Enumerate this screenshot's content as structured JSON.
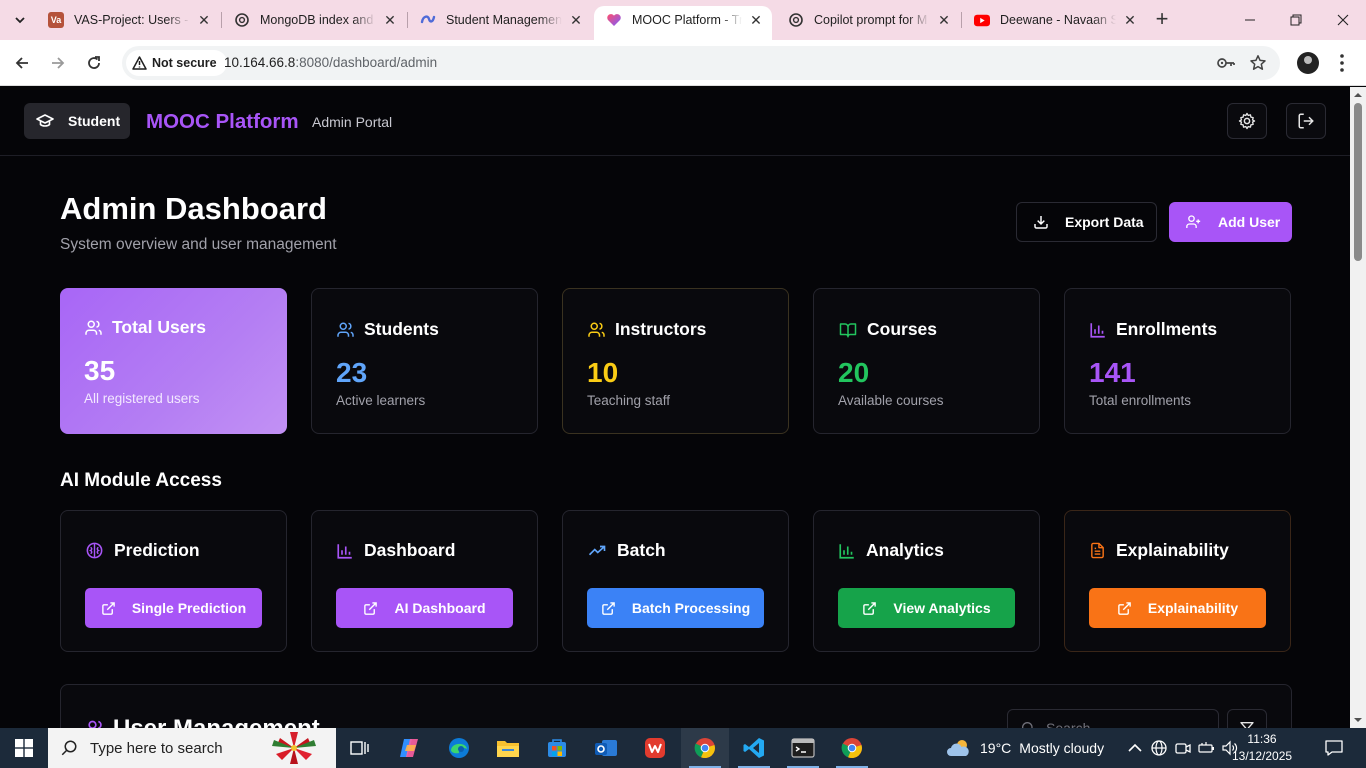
{
  "browser": {
    "tabs": [
      {
        "title": "VAS-Project: Users - A",
        "favicon_text": "Va",
        "favicon_color": "#b5523b",
        "active": false
      },
      {
        "title": "MongoDB index and",
        "favicon_icon": "openai-icon",
        "active": false
      },
      {
        "title": "Student Management",
        "favicon_icon": "copilot-icon",
        "active": false
      },
      {
        "title": "MOOC Platform - Tra",
        "favicon_icon": "lovable-heart-icon",
        "active": true
      },
      {
        "title": "Copilot prompt for M",
        "favicon_icon": "openai-icon",
        "active": false
      },
      {
        "title": "Deewane - Navaan S",
        "favicon_icon": "youtube-icon",
        "active": false
      }
    ],
    "security_label": "Not secure",
    "url_host": "10.164.66.8",
    "url_rest": ":8080/dashboard/admin"
  },
  "header": {
    "role_label": "Student",
    "brand": "MOOC Platform",
    "portal": "Admin Portal"
  },
  "dashboard": {
    "title": "Admin Dashboard",
    "subtitle": "System overview and user management",
    "export_label": "Export Data",
    "add_user_label": "Add User"
  },
  "stats": [
    {
      "label": "Total Users",
      "value": "35",
      "caption": "All registered users",
      "color": "#ffffff",
      "icon": "users-icon"
    },
    {
      "label": "Students",
      "value": "23",
      "caption": "Active learners",
      "color": "#60a5fa",
      "icon": "users-icon"
    },
    {
      "label": "Instructors",
      "value": "10",
      "caption": "Teaching staff",
      "color": "#facc15",
      "icon": "users-icon"
    },
    {
      "label": "Courses",
      "value": "20",
      "caption": "Available courses",
      "color": "#22c55e",
      "icon": "book-open-icon"
    },
    {
      "label": "Enrollments",
      "value": "141",
      "caption": "Total enrollments",
      "color": "#a855f7",
      "icon": "bar-chart-icon"
    }
  ],
  "ai_modules": {
    "title": "AI Module Access",
    "items": [
      {
        "label": "Prediction",
        "button": "Single Prediction",
        "color": "#a855f7",
        "icon": "brain-icon"
      },
      {
        "label": "Dashboard",
        "button": "AI Dashboard",
        "color": "#a855f7",
        "icon": "bar-chart-icon"
      },
      {
        "label": "Batch",
        "button": "Batch Processing",
        "color": "#3b82f6",
        "icon": "trending-up-icon"
      },
      {
        "label": "Analytics",
        "button": "View Analytics",
        "color": "#16a34a",
        "icon": "bar-chart-icon"
      },
      {
        "label": "Explainability",
        "button": "Explainability",
        "color": "#f97316",
        "icon": "file-text-icon"
      }
    ]
  },
  "user_management": {
    "title": "User Management",
    "search_placeholder": "Search..."
  },
  "taskbar": {
    "search_placeholder": "Type here to search",
    "temperature": "19°C",
    "weather": "Mostly cloudy",
    "time": "11:36",
    "date": "13/12/2025"
  }
}
